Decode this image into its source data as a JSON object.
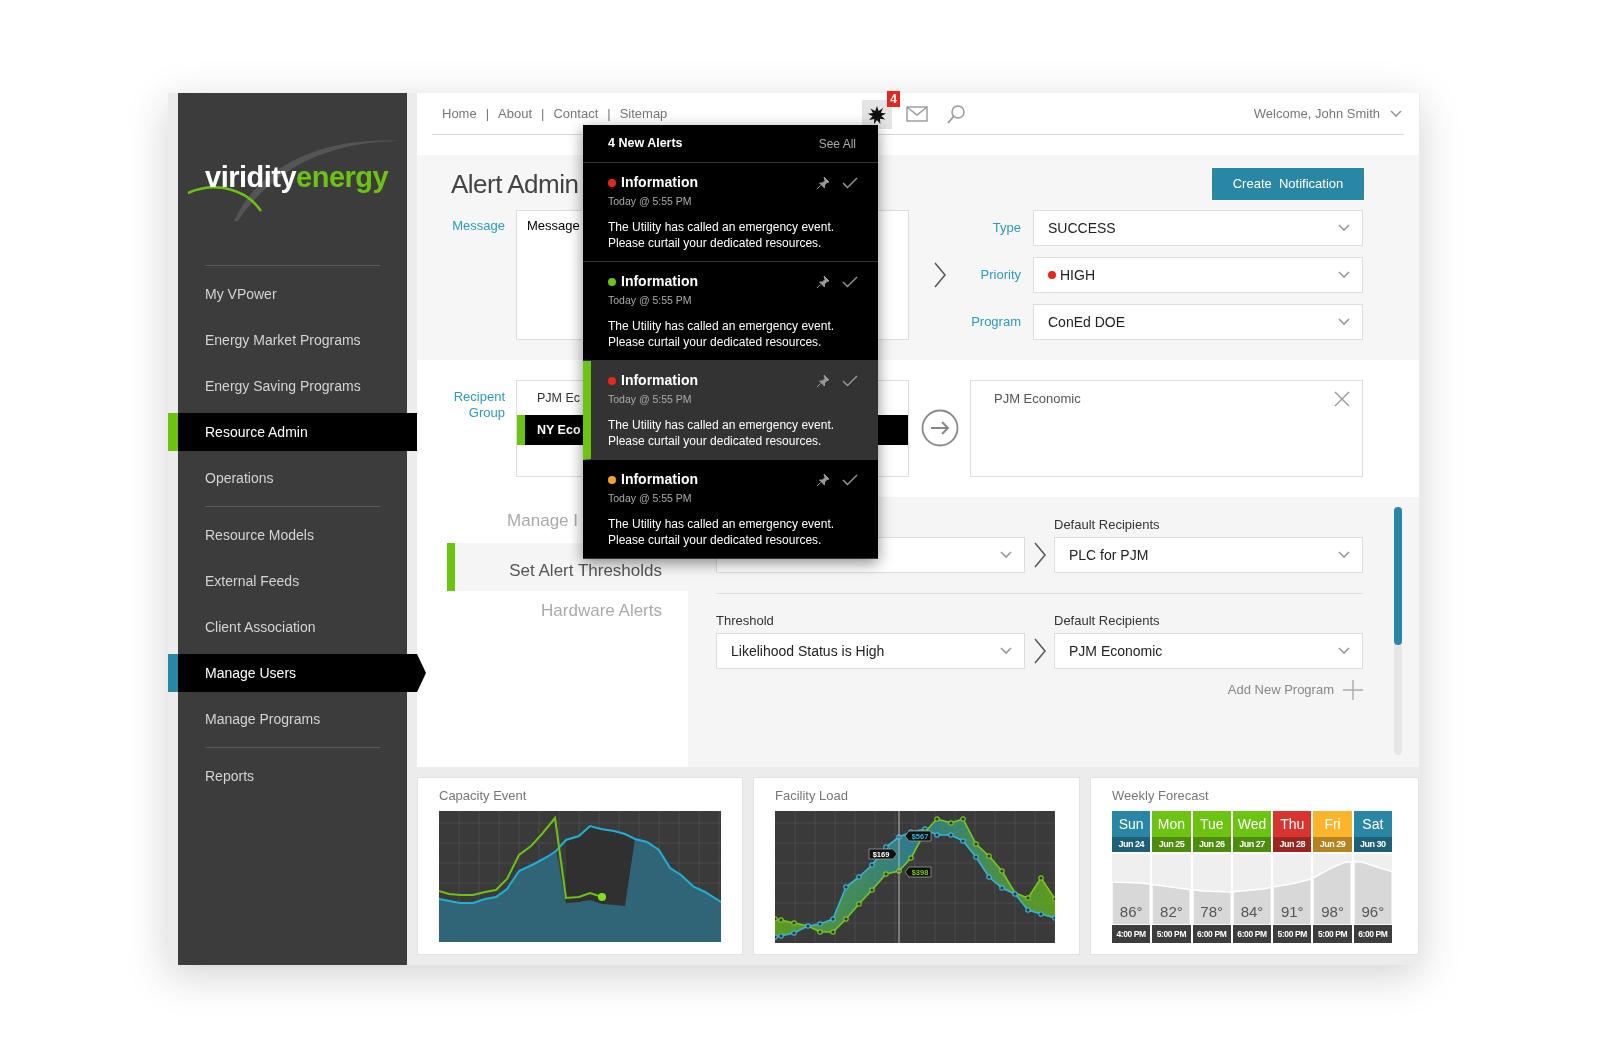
{
  "sidebar": {
    "logo": {
      "word_1": "viridity",
      "word_2": "energy"
    },
    "groups": [
      [
        {
          "label": "My VPower",
          "selected": false,
          "current": false
        },
        {
          "label": "Energy Market Programs",
          "selected": false,
          "current": false
        },
        {
          "label": "Energy Saving Programs",
          "selected": false,
          "current": false
        },
        {
          "label": "Resource Admin",
          "selected": true,
          "current": false
        },
        {
          "label": "Operations",
          "selected": false,
          "current": false
        }
      ],
      [
        {
          "label": "Resource Models",
          "selected": false,
          "current": false
        },
        {
          "label": "External Feeds",
          "selected": false,
          "current": false
        },
        {
          "label": "Client Association",
          "selected": false,
          "current": false
        },
        {
          "label": "Manage Users",
          "selected": false,
          "current": true
        },
        {
          "label": "Manage Programs",
          "selected": false,
          "current": false
        }
      ],
      [
        {
          "label": "Reports",
          "selected": false,
          "current": false
        }
      ]
    ]
  },
  "top_nav": {
    "links": [
      "Home",
      "About",
      "Contact",
      "Sitemap"
    ],
    "separator": "|",
    "alert_count": "4",
    "welcome": "Welcome, John Smith"
  },
  "alerts_popup": {
    "title": "4 New Alerts",
    "see_all": "See All",
    "items": [
      {
        "title": "Information",
        "time": "Today @ 5:55 PM",
        "message": "The Utility has called an emergency event.\nPlease curtail your dedicated resources.",
        "color": "#e8261b",
        "selected": false
      },
      {
        "title": "Information",
        "time": "Today @ 5:55 PM",
        "message": "The Utility has called an emergency event.\nPlease curtail your dedicated resources.",
        "color": "#6cc312",
        "selected": false
      },
      {
        "title": "Information",
        "time": "Today @ 5:55 PM",
        "message": "The Utility has called an emergency event.\nPlease curtail your dedicated resources.",
        "color": "#e8261b",
        "selected": true
      },
      {
        "title": "Information",
        "time": "Today @ 5:55 PM",
        "message": "The Utility has called an emergency event.\nPlease curtail your dedicated resources.",
        "color": "#f5a623",
        "selected": false
      }
    ]
  },
  "alert_admin": {
    "title": "Alert Admin",
    "create_button": "Create  Notification",
    "message": {
      "label": "Message",
      "placeholder": "Message"
    },
    "fields": [
      {
        "label": "Type",
        "value": "SUCCESS"
      },
      {
        "label": "Priority",
        "value": "HIGH",
        "color": "#e8261b"
      },
      {
        "label": "Program",
        "value": "ConEd DOE"
      }
    ]
  },
  "recipients": {
    "label": "Recipent Group",
    "groups": [
      {
        "label": "PJM Ec",
        "selected": false
      },
      {
        "label": "NY Eco",
        "selected": true
      }
    ],
    "chosen": [
      "PJM Economic"
    ]
  },
  "left_tabs": [
    {
      "label": "Manage I",
      "selected": false
    },
    {
      "label": "Set Alert Thresholds",
      "selected": true
    },
    {
      "label": "Hardware Alerts",
      "selected": false
    }
  ],
  "threshold_rows": [
    {
      "recipients_label": "Default Recipients",
      "recipients": "PLC for PJM"
    },
    {
      "threshold_label": "Threshold",
      "threshold": "Likelihood Status is High",
      "recipients_label": "Default Recipients",
      "recipients": "PJM Economic"
    }
  ],
  "add_program": "Add New Program",
  "capacity_event": {
    "title": "Capacity Event"
  },
  "facility_load": {
    "title": "Facility Load",
    "tags": [
      {
        "text": "$567",
        "kind": "blue"
      },
      {
        "text": "$169",
        "kind": "neutral"
      },
      {
        "text": "$398",
        "kind": "green"
      }
    ]
  },
  "weekly_forecast": {
    "title": "Weekly Forecast",
    "days": [
      {
        "day": "Sun",
        "date": "Jun 24",
        "temp": "86°",
        "time": "4:00 PM",
        "color": "#2a86a5"
      },
      {
        "day": "Mon",
        "date": "Jun 25",
        "temp": "82°",
        "time": "5:00 PM",
        "color": "#6cc312"
      },
      {
        "day": "Tue",
        "date": "Jun 26",
        "temp": "78°",
        "time": "6:00 PM",
        "color": "#6cc312"
      },
      {
        "day": "Wed",
        "date": "Jun 27",
        "temp": "84°",
        "time": "6:00 PM",
        "color": "#6cc312"
      },
      {
        "day": "Thu",
        "date": "Jun 28",
        "temp": "91°",
        "time": "5:00 PM",
        "color": "#d9342f"
      },
      {
        "day": "Fri",
        "date": "Jun 29",
        "temp": "98°",
        "time": "5:00 PM",
        "color": "#fbb52d"
      },
      {
        "day": "Sat",
        "date": "Jun 30",
        "temp": "96°",
        "time": "6:00 PM",
        "color": "#2a86a5"
      }
    ]
  }
}
